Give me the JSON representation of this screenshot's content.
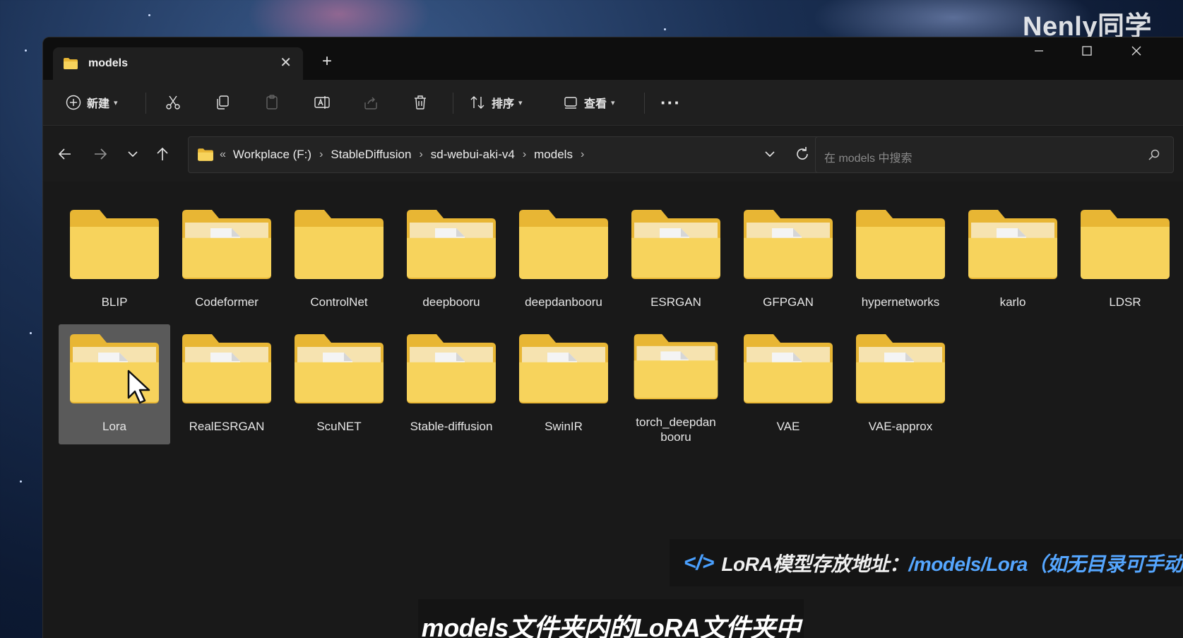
{
  "watermark": "Nenly同学",
  "tab": {
    "title": "models",
    "close": "✕",
    "new_tab": "+"
  },
  "window_controls": {
    "minimize": "—",
    "maximize": "☐",
    "close": "✕"
  },
  "toolbar": {
    "new_label": "新建",
    "sort_label": "排序",
    "view_label": "查看",
    "more": "···"
  },
  "address": {
    "overflow": "«",
    "crumbs": [
      "Workplace (F:)",
      "StableDiffusion",
      "sd-webui-aki-v4",
      "models"
    ],
    "sep": "›"
  },
  "search": {
    "placeholder": "在 models 中搜索"
  },
  "folders": [
    {
      "name": "BLIP",
      "has_files": false
    },
    {
      "name": "Codeformer",
      "has_files": true
    },
    {
      "name": "ControlNet",
      "has_files": false
    },
    {
      "name": "deepbooru",
      "has_files": true
    },
    {
      "name": "deepdanbooru",
      "has_files": false
    },
    {
      "name": "ESRGAN",
      "has_files": true
    },
    {
      "name": "GFPGAN",
      "has_files": true
    },
    {
      "name": "hypernetworks",
      "has_files": false
    },
    {
      "name": "karlo",
      "has_files": true
    },
    {
      "name": "LDSR",
      "has_files": false
    },
    {
      "name": "Lora",
      "has_files": true,
      "selected": true
    },
    {
      "name": "RealESRGAN",
      "has_files": true
    },
    {
      "name": "ScuNET",
      "has_files": true
    },
    {
      "name": "Stable-diffusion",
      "has_files": true
    },
    {
      "name": "SwinIR",
      "has_files": true
    },
    {
      "name": "torch_deepdanbooru",
      "has_files": true
    },
    {
      "name": "VAE",
      "has_files": true
    },
    {
      "name": "VAE-approx",
      "has_files": true
    }
  ],
  "note": {
    "icon": "</>",
    "prefix": "LoRA模型存放地址：",
    "path": "/models/Lora（如无目录可手动新建）"
  },
  "subtitle": "models文件夹内的LoRA文件夹中",
  "colors": {
    "folder_back": "#e8b634",
    "folder_front": "#f7d35c",
    "accent": "#4aa0ff"
  }
}
